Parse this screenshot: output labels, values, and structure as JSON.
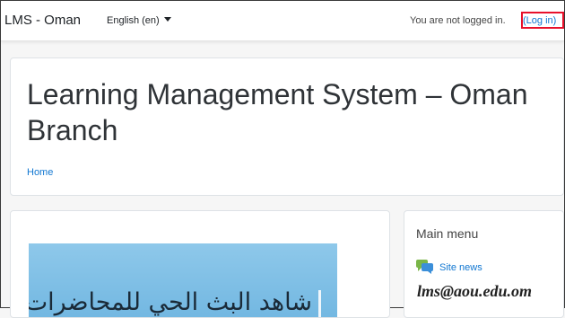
{
  "navbar": {
    "brand": "LMS - Oman",
    "language": "English (en)",
    "login_status": "You are not logged in.",
    "login_link": "(Log in)"
  },
  "header": {
    "site_title": "Learning Management System – Oman Branch",
    "breadcrumb_home": "Home"
  },
  "main": {
    "banner_text": "شاهد البث الحي للمحاضرات"
  },
  "sidebar": {
    "title": "Main menu",
    "items": [
      {
        "label": "Site news",
        "icon": "chat-bubbles-icon"
      }
    ]
  },
  "overlay": {
    "email": "lms@aou.edu.om"
  },
  "colors": {
    "link": "#1177d1",
    "highlight_box": "#e8112b",
    "banner": "#7cbfe6"
  }
}
